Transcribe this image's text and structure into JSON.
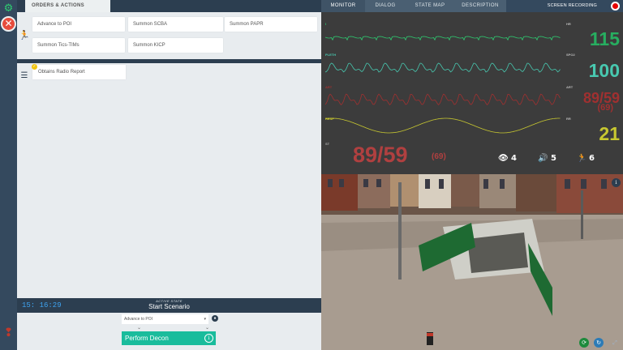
{
  "left_tabs": {
    "orders_actions": "ORDERS & ACTIONS"
  },
  "actions": [
    "Advance to POI",
    "Summon SCBA",
    "Summon PAPR",
    "Summon Tics-TIMs",
    "Summon KICP"
  ],
  "reports": [
    "Obtains Radio Report"
  ],
  "timer": "15: 16:29",
  "active_state": {
    "label": "ACTIVE STATE",
    "name": "Start Scenario"
  },
  "next_state": {
    "selected": "Advance to POI",
    "action_label": "Perform Decon"
  },
  "right_tabs": [
    "MONITOR",
    "DIALOG",
    "STATE MAP",
    "DESCRIPTION"
  ],
  "screen_recording": "SCREEN RECORDING",
  "monitor": {
    "waveforms": [
      {
        "label": "I",
        "color": "#2ecc71"
      },
      {
        "label": "PLETH",
        "color": "#48c9b0"
      },
      {
        "label": "ART",
        "color": "#a03030"
      },
      {
        "label": "RESP",
        "color": "#c8c830"
      },
      {
        "label": "ST",
        "color": "#aaaaaa"
      }
    ],
    "vitals": {
      "hr": {
        "label": "HR",
        "value": "115",
        "color": "#27ae60"
      },
      "spo2": {
        "label": "SPO2",
        "value": "100",
        "color": "#48c9b0"
      },
      "art": {
        "label": "ART",
        "value": "89/59",
        "map": "(69)",
        "color": "#a03030"
      },
      "rr": {
        "label": "RR",
        "value": "21",
        "color": "#c8c830"
      }
    },
    "big_bp": "89/59",
    "big_map": "(69)",
    "stats": {
      "views": "4",
      "sound": "5",
      "moves": "6"
    }
  },
  "colors": {
    "accent_green": "#1abc9c",
    "record_red": "#e60000",
    "dark_blue": "#2c3e50"
  }
}
